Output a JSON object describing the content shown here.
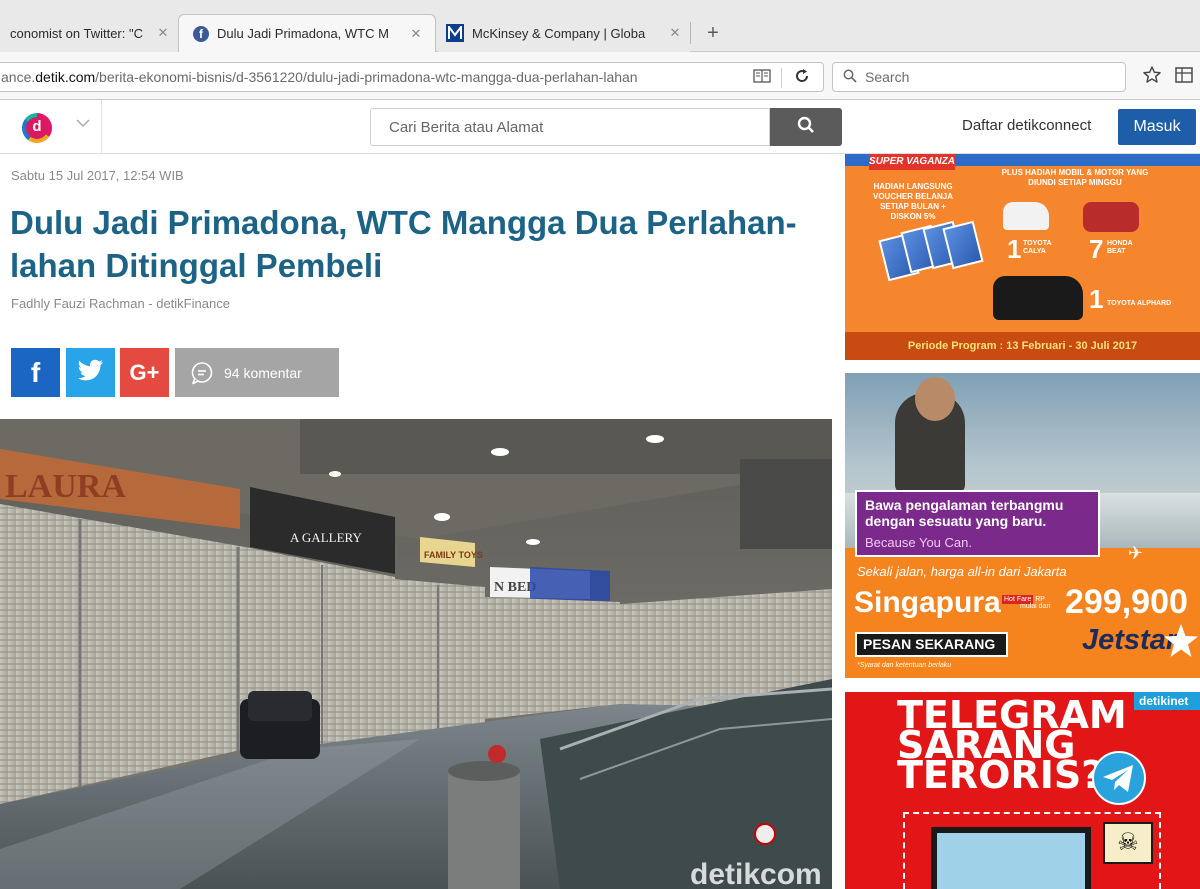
{
  "browser": {
    "tabs": [
      {
        "title": "conomist on Twitter: \"C",
        "active": false
      },
      {
        "title": "Dulu Jadi Primadona, WTC M",
        "active": true
      },
      {
        "title": "McKinsey & Company | Globa",
        "active": false
      }
    ],
    "close_glyph": "✕",
    "new_tab_glyph": "+",
    "url_prefix": "ance.",
    "url_domain": "detik.com",
    "url_path": "/berita-ekonomi-bisnis/d-3561220/dulu-jadi-primadona-wtc-mangga-dua-perlahan-lahan",
    "search_placeholder": "Search"
  },
  "header": {
    "logo_letter": "d",
    "search_placeholder": "Cari Berita atau Alamat",
    "register_label": "Daftar detikconnect",
    "login_label": "Masuk"
  },
  "article": {
    "date": "Sabtu 15 Jul 2017, 12:54 WIB",
    "title": "Dulu Jadi Primadona, WTC Mangga Dua Perlahan-lahan Ditinggal Pembeli",
    "byline": "Fadhly Fauzi Rachman - detikFinance",
    "share": {
      "facebook": "f",
      "google": "G+"
    },
    "comments_label": "94 komentar",
    "photo_signs": {
      "store1": "LAURA",
      "store2": "A GALLERY",
      "store3": "FAMILY TOYS",
      "store4": "N BED",
      "watermark": "detikcom"
    }
  },
  "ads": {
    "ad1": {
      "banner": "SUPER VAGANZA",
      "left_text": "HADIAH LANGSUNG VOUCHER BELANJA SETIAP BULAN + DISKON 5%",
      "right_text": "PLUS HADIAH MOBIL & MOTOR YANG DIUNDI SETIAP MINGGU",
      "prize1_n": "1",
      "prize1_t": "TOYOTA CALYA",
      "prize2_n": "7",
      "prize2_t": "HONDA BEAT",
      "prize3_n": "1",
      "prize3_t": "TOYOTA ALPHARD",
      "period": "Periode Program : 13 Februari - 30 Juli 2017"
    },
    "ad2": {
      "line1": "Bawa pengalaman terbangmu",
      "line2": "dengan sesuatu yang baru.",
      "line3": "Because You Can.",
      "sub": "Sekali jalan, harga all-in dari Jakarta",
      "city": "Singapura",
      "hot": "Hot Fare",
      "hot_sub": "mulai dari",
      "currency": "RP",
      "price": "299,900",
      "cta": "PESAN SEKARANG",
      "disclaimer": "*Syarat dan ketentuan berlaku",
      "brand": "Jetstar"
    },
    "ad3": {
      "brand": "detikinet",
      "line1": "TELEGRAM",
      "line2": "SARANG",
      "line3": "TERORIS?"
    }
  },
  "colors": {
    "headline": "#1d6386",
    "login_button": "#1e5da8",
    "facebook": "#1c66c3",
    "twitter": "#27a5e8",
    "google": "#e54a40"
  }
}
